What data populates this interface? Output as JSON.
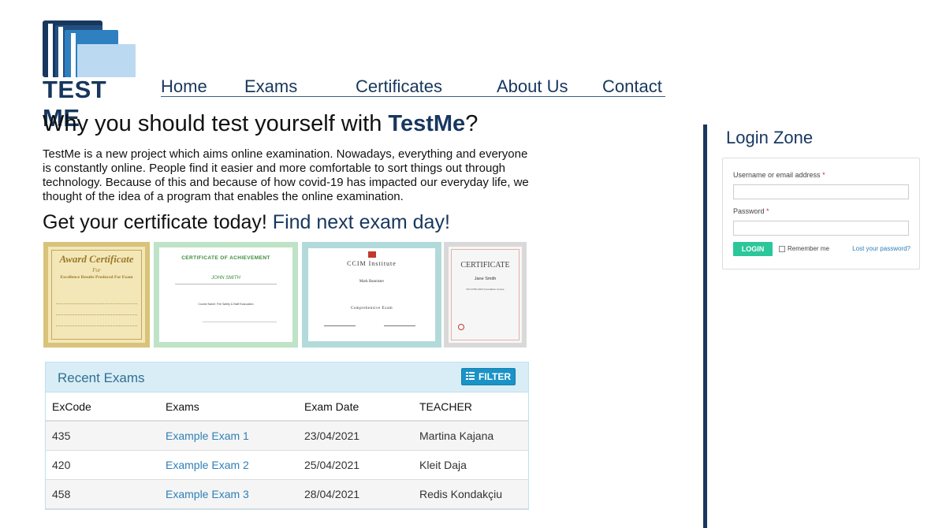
{
  "logo": {
    "text": "TEST ME",
    "colors": [
      "#17375e",
      "#234f80",
      "#2f80c0",
      "#bcd9f2"
    ]
  },
  "nav": {
    "items": [
      {
        "label": "Home"
      },
      {
        "label": "Exams"
      },
      {
        "label": "Certificates"
      },
      {
        "label": "About Us"
      },
      {
        "label": "Contact"
      }
    ]
  },
  "hero": {
    "headline_prefix": "Why you should test yourself with ",
    "headline_brand": "TestMe",
    "headline_suffix": "?",
    "intro": "TestMe is a new project which aims online examination. Nowadays, everything and everyone is constantly online. People find it easier and more comfortable to sort things out through technology. Because of this and because of how covid-19 has impacted our everyday life, we thought of the idea of a program that enables the online examination.",
    "sub_prefix": "Get your certificate today! ",
    "sub_accent": "Find next exam day!"
  },
  "certificates": [
    {
      "title": "Award Certificate",
      "line1": "For",
      "line2": "Excellence Results Produced For Exam",
      "style": "gold"
    },
    {
      "title": "CERTIFICATE OF ACHIEVEMENT",
      "line1": "JOHN SMITH",
      "line2": "Course Name: Fire Safety & Staff Evacuation",
      "style": "green"
    },
    {
      "title": "CCIM Institute",
      "line1": "Mark Bannister",
      "line2": "Comprehensive Exam",
      "style": "teal"
    },
    {
      "title": "Certificate",
      "line1": "Jane Smith",
      "line2": "ISO 27001:2013 Foundation Course",
      "style": "gray"
    }
  ],
  "exams": {
    "title": "Recent Exams",
    "filter_label": "FILTER",
    "columns": [
      "ExCode",
      "Exams",
      "Exam Date",
      "TEACHER"
    ],
    "rows": [
      {
        "code": "435",
        "name": "Example Exam 1",
        "date": "23/04/2021",
        "teacher": "Martina Kajana"
      },
      {
        "code": "420",
        "name": "Example Exam 2",
        "date": "25/04/2021",
        "teacher": "Kleit Daja"
      },
      {
        "code": "458",
        "name": "Example Exam 3",
        "date": "28/04/2021",
        "teacher": "Redis Kondakçiu"
      }
    ]
  },
  "login": {
    "title": "Login Zone",
    "username_label": "Username or email address",
    "password_label": "Password",
    "required_mark": "*",
    "button_label": "LOGIN",
    "remember_label": "Remember me",
    "lost_password_label": "Lost your password?",
    "accent_color": "#2bc79a"
  }
}
